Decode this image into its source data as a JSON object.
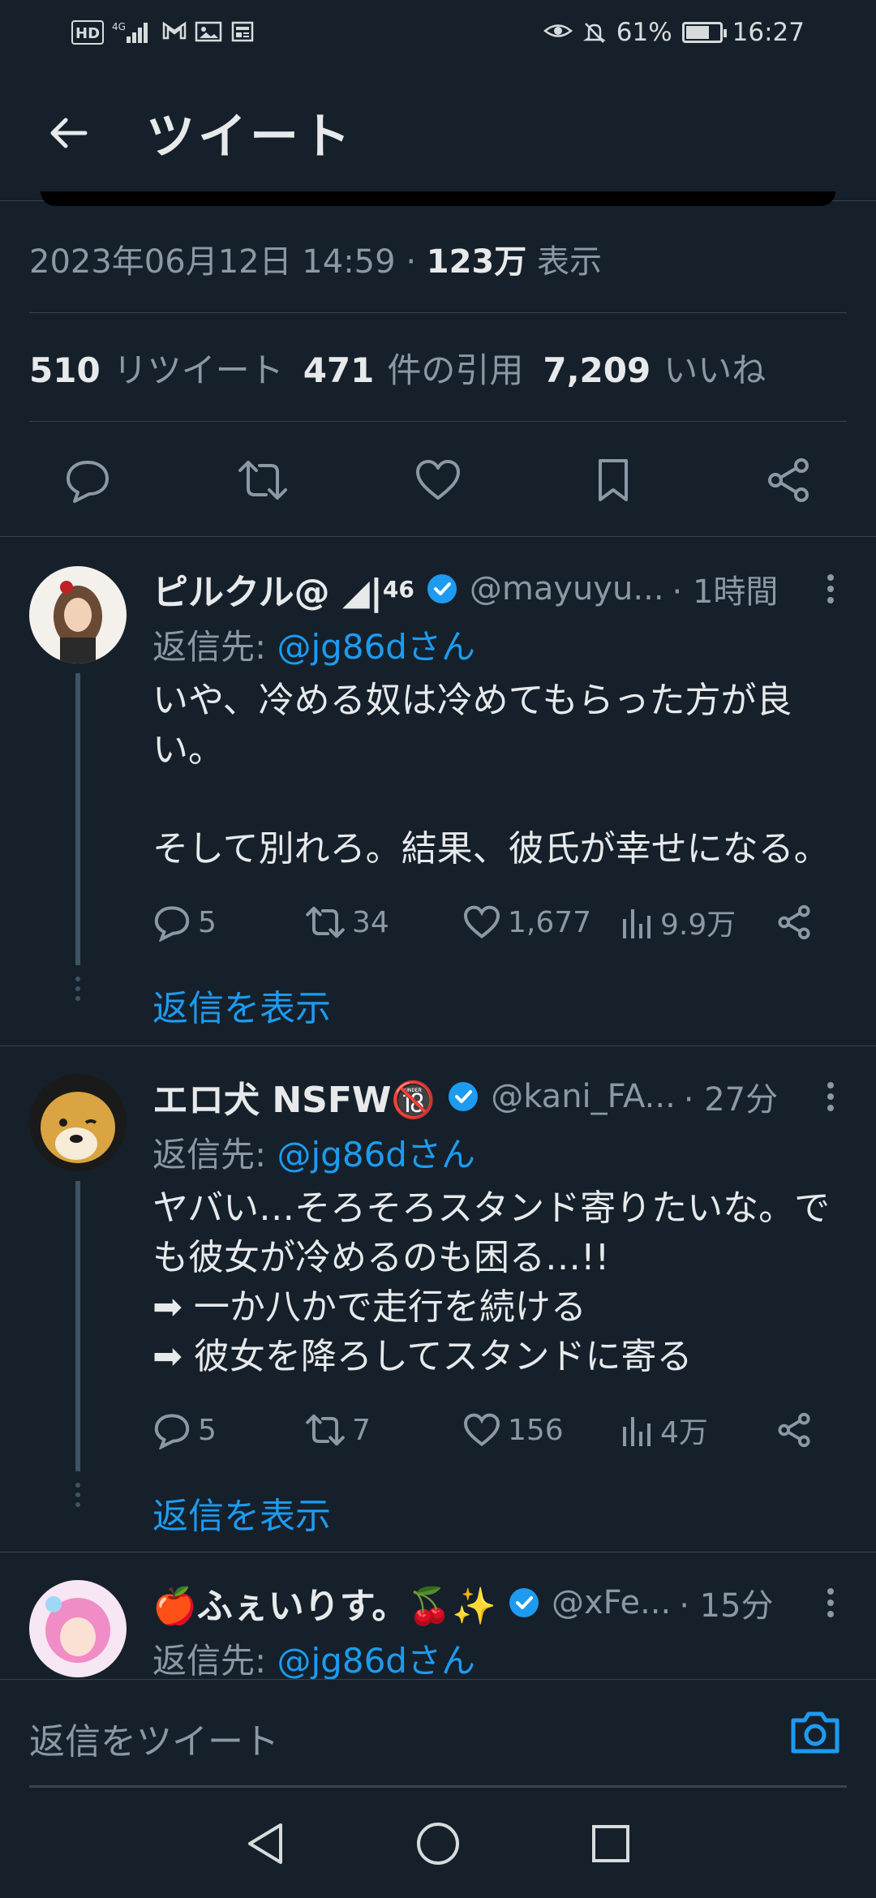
{
  "status_bar": {
    "left_icons": [
      "hd-icon",
      "signal-4g-icon",
      "gmail-icon",
      "gallery-icon",
      "news-icon"
    ],
    "hd_text": "HD",
    "network_text": "4G",
    "battery_pct": "61%",
    "time": "16:27"
  },
  "header": {
    "title": "ツイート"
  },
  "tweet_meta": {
    "datetime": "2023年06月12日 14:59",
    "sep": "·",
    "views_value": "123万",
    "views_label": "表示"
  },
  "stats": {
    "retweets_value": "510",
    "retweets_label": "リツイート",
    "quotes_value": "471",
    "quotes_label": "件の引用",
    "likes_value": "7,209",
    "likes_label": "いいね"
  },
  "replies": [
    {
      "name": "ピルクル@ ◢|",
      "name_sup": "46",
      "handle": "@mayuyu...",
      "time": "· 1時間",
      "replyto_label": "返信先: ",
      "replyto_mention": "@jg86dさん",
      "text": "いや、冷める奴は冷めてもらった方が良い。\n\nそして別れろ。結果、彼氏が幸せになる。",
      "replies": "5",
      "retweets": "34",
      "likes": "1,677",
      "views": "9.9万",
      "show_replies": "返信を表示"
    },
    {
      "name": "エロ犬 NSFW🔞",
      "name_sup": "",
      "handle": "@kani_FA...",
      "time": "· 27分",
      "replyto_label": "返信先: ",
      "replyto_mention": "@jg86dさん",
      "text": "ヤバい…そろそろスタンド寄りたいな。でも彼女が冷めるのも困る…!!\n➡ 一か八かで走行を続ける\n➡ 彼女を降ろしてスタンドに寄る",
      "replies": "5",
      "retweets": "7",
      "likes": "156",
      "views": "4万",
      "show_replies": "返信を表示"
    },
    {
      "name": "🍎ふぇいりす。🍒✨",
      "name_sup": "",
      "handle": "@xFe...",
      "time": "· 15分",
      "replyto_label": "返信先: ",
      "replyto_mention": "@jg86dさん"
    }
  ],
  "compose": {
    "placeholder": "返信をツイート"
  },
  "colors": {
    "background": "#15202b",
    "accent": "#1d9bf0",
    "muted": "#8b98a5",
    "divider": "#38444d"
  }
}
